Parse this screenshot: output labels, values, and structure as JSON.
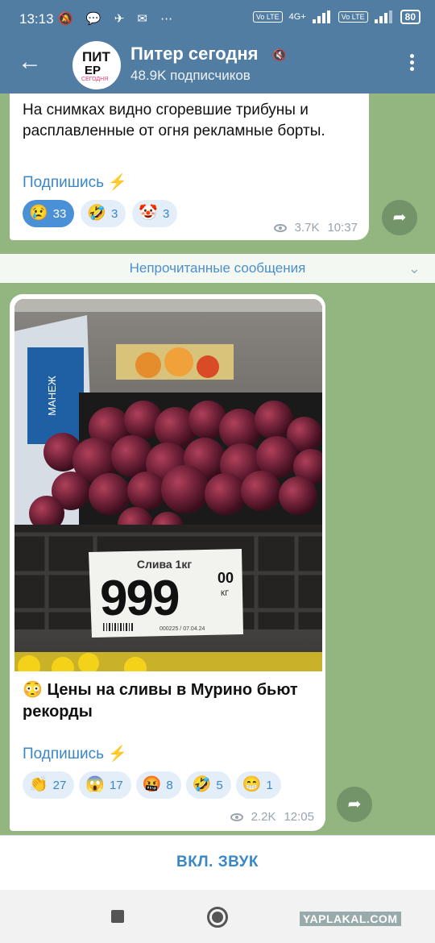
{
  "status_bar": {
    "time": "13:13",
    "left_icons": "🔕 💬 ✈ ✉ ⋯",
    "network": "4G+",
    "volte": "Vo LTE",
    "battery": "80"
  },
  "header": {
    "avatar_line1": "ПИТ",
    "avatar_line2": "ЕР",
    "avatar_line3": "СЕГОДНЯ",
    "title": "Питер сегодня",
    "subtitle": "48.9K подписчиков",
    "accent": "#527da3"
  },
  "messages": [
    {
      "text": "На снимках видно сгоревшие трибуны и расплавленные от огня рекламные борты.",
      "subscribe": "Подпишись ⚡",
      "reactions": [
        {
          "emoji": "😢",
          "count": "33",
          "active": true
        },
        {
          "emoji": "🤣",
          "count": "3",
          "active": false
        },
        {
          "emoji": "🤡",
          "count": "3",
          "active": false
        }
      ],
      "views": "3.7K",
      "time": "10:37"
    },
    {
      "photo": {
        "sign_brand": "МАНЕЖ",
        "price_label": "Слива 1кг",
        "price_main": "999",
        "price_cents": "00",
        "price_unit": "КГ",
        "barcode_text": "000225 / 07.04.24"
      },
      "text": "😳 Цены на сливы в Мурино бьют рекорды",
      "subscribe": "Подпишись ⚡",
      "reactions": [
        {
          "emoji": "👏",
          "count": "27"
        },
        {
          "emoji": "😱",
          "count": "17"
        },
        {
          "emoji": "🤬",
          "count": "8"
        },
        {
          "emoji": "🤣",
          "count": "5"
        },
        {
          "emoji": "😁",
          "count": "1"
        }
      ],
      "views": "2.2K",
      "time": "12:05"
    }
  ],
  "unread_divider": "Непрочитанные сообщения",
  "sound_button": "ВКЛ. ЗВУК",
  "watermark": "YAPLAKAL.COM"
}
